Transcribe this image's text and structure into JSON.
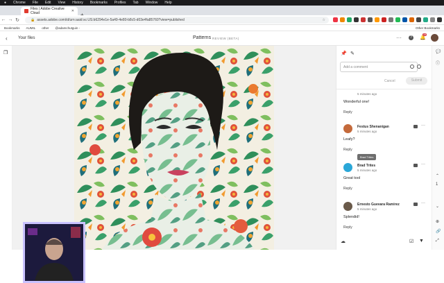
{
  "macos_menu": {
    "apple": "",
    "items": [
      "Chrome",
      "File",
      "Edit",
      "View",
      "History",
      "Bookmarks",
      "Profiles",
      "Tab",
      "Window",
      "Help"
    ]
  },
  "browser": {
    "tab_title": "Files | Adobe Creative Cloud",
    "url": "assets.adobe.com/id/urn:aaid:sc:US:b6294e1e-5a49-4e80-b8c5-d03e4fa85760?view=published",
    "bookmarks": [
      "Bookmarks",
      "AUMIL",
      "other",
      "@adamchutguin -"
    ],
    "other_bookmarks": "Other Bookmarks"
  },
  "app": {
    "back_label": "Your files",
    "doc_title": "Patterns",
    "review_badge": "REVIEW (BETA)",
    "notifications_count": "19"
  },
  "comments_panel": {
    "input_placeholder": "Add a comment",
    "cancel_label": "Cancel",
    "submit_label": "Submit",
    "comments": [
      {
        "name": "",
        "time": "5 minutes ago",
        "text": "Wonderful one!",
        "reply": "Reply",
        "avatar_color": "#b07a5a"
      },
      {
        "name": "Festus Shenanigan",
        "time": "5 minutes ago",
        "text": "Leafy?",
        "reply": "Reply",
        "avatar_color": "#c46a3b"
      },
      {
        "name": "Brad Trites",
        "time": "5 minutes ago",
        "text": "Great tool",
        "reply": "Reply",
        "avatar_color": "#2aa7d8"
      },
      {
        "name": "Ernesto Guevara Ramirez",
        "time": "5 minutes ago",
        "text": "Splendid!",
        "reply": "Reply",
        "avatar_color": "#6a5a4a"
      }
    ],
    "tooltip": "Brad Trites"
  },
  "colors": {
    "accent": "#1473e6",
    "badge": "#d7373f",
    "webcam_border": "#c9c2ff"
  }
}
